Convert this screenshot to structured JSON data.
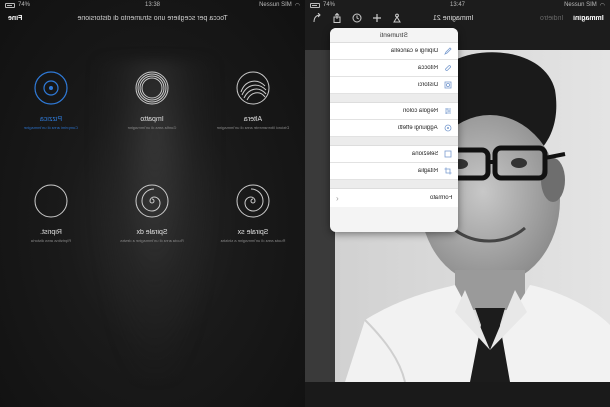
{
  "left": {
    "status": {
      "carrier": "Nessun SIM",
      "time": "13:38",
      "battery": "74%"
    },
    "toolbar": {
      "hint": "Tocca per scegliere uno strumento di distorsione",
      "done_label": "Fine"
    },
    "tools": [
      {
        "name": "Pizzica",
        "desc": "Comprimi area di un'immagine",
        "active": true
      },
      {
        "name": "Impatto",
        "desc": "Gonfia area di un'immagine",
        "active": false
      },
      {
        "name": "Altera",
        "desc": "Distorci liberamente area di un'immagine",
        "active": false
      },
      {
        "name": "Riprist.",
        "desc": "Ripristina area distorta",
        "active": false
      },
      {
        "name": "Spirale dx",
        "desc": "Ruota area di un'immagine a destra",
        "active": false
      },
      {
        "name": "Spirale sx",
        "desc": "Ruota area di un'immagine a sinistra",
        "active": false
      }
    ],
    "accent_color": "#2f7ad8"
  },
  "right": {
    "status": {
      "carrier": "Nessun SIM",
      "time": "13:47",
      "battery": "74%"
    },
    "toolbar": {
      "image_title": "Immagine 21",
      "tab_inactive": "Indietro",
      "tab_active": "Immagini"
    },
    "popover": {
      "title": "Strumenti",
      "group1": [
        "Dipingi e cancella",
        "Ritocca",
        "Distorci"
      ],
      "group2": [
        "Regola colori",
        "Aggiungi effetti"
      ],
      "group3": [
        "Seleziona",
        "Ritaglia"
      ],
      "footer": "Formato"
    },
    "icons": [
      "back-curve-icon",
      "share-icon",
      "history-icon",
      "add-icon",
      "brush-icon"
    ]
  }
}
